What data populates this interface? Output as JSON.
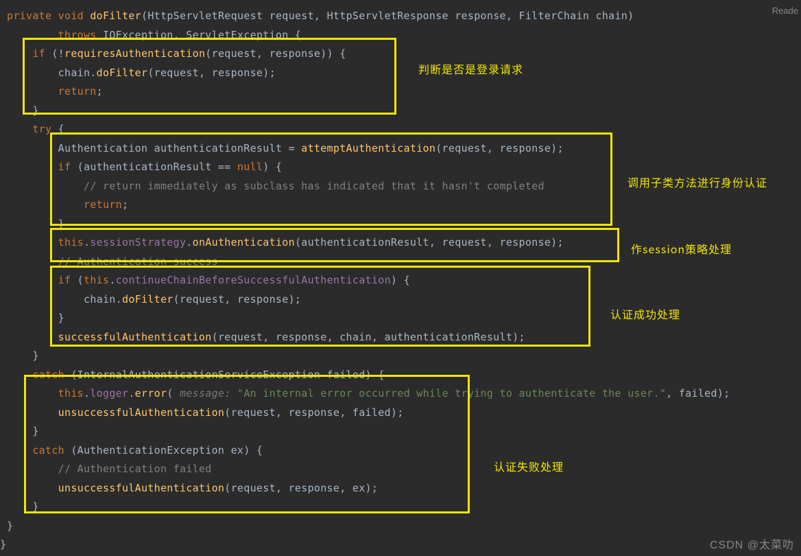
{
  "reader_label": "Reade",
  "watermark": "CSDN @太菜叻",
  "anno": {
    "check_login": "判断是否是登录请求",
    "call_subclass": "调用子类方法进行身份认证",
    "session_policy": "作session策略处理",
    "auth_ok": "认证成功处理",
    "auth_fail": "认证失败处理"
  },
  "code": {
    "lines": {
      "l1_private": "private",
      "l1_void": "void",
      "l1_doFilter": "doFilter",
      "l1_params": "(HttpServletRequest request, HttpServletResponse response, FilterChain chain)",
      "l2_throws": "throws",
      "l2_exceptions": " IOException, ServletException {",
      "l3_if": "if",
      "l3_cond_a": " (!",
      "l3_requiresAuthentication": "requiresAuthentication",
      "l3_cond_b": "(request, response)) {",
      "l4a": "chain.",
      "l4_doFilter": "doFilter",
      "l4b": "(request, response);",
      "l5_return": "return",
      "l5_semi": ";",
      "l6_close": "}",
      "l7_try": "try",
      "l7_open": " {",
      "l8_auth_a": "Authentication authenticationResult = ",
      "l8_attemptAuthentication": "attemptAuthentication",
      "l8_auth_b": "(request, response);",
      "l9_if": "if",
      "l9_cond_a": " (authenticationResult == ",
      "l9_null": "null",
      "l9_cond_b": ") {",
      "l10_cmt": "// return immediately as subclass has indicated that it hasn't completed",
      "l11_return": "return",
      "l11_semi": ";",
      "l12_close": "}",
      "l13_this": "this",
      "l13_dot1": ".",
      "l13_sessionStrategy": "sessionStrategy",
      "l13_dot2": ".",
      "l13_onAuthentication": "onAuthentication",
      "l13_args": "(authenticationResult, request, response);",
      "l14_cmt": "// Authentication success",
      "l15_if": "if",
      "l15_cond_a": " (",
      "l15_this": "this",
      "l15_dot": ".",
      "l15_continueChain": "continueChainBeforeSuccessfulAuthentication",
      "l15_cond_b": ") {",
      "l16a": "chain.",
      "l16_doFilter": "doFilter",
      "l16b": "(request, response);",
      "l17_close": "}",
      "l18_successfulAuth": "successfulAuthentication",
      "l18_args": "(request, response, chain, authenticationResult);",
      "l19_close": "}",
      "l20_catch": "catch",
      "l20_a": " (InternalAuthenticationServiceException failed) {",
      "l21_this": "this",
      "l21_dot": ".",
      "l21_logger": "logger",
      "l21_dot2": ".",
      "l21_error": "error",
      "l21_open": "(",
      "l21_hint": " message: ",
      "l21_str": "\"An internal error occurred while trying to authenticate the user.\"",
      "l21_end": ", failed);",
      "l22_unsuc": "unsuccessfulAuthentication",
      "l22_args": "(request, response, failed);",
      "l23_close": "}",
      "l24_catch": "catch",
      "l24_a": " (AuthenticationException ex) {",
      "l25_cmt": "// Authentication failed",
      "l26_unsuc": "unsuccessfulAuthentication",
      "l26_args": "(request, response, ex);",
      "l27_close": "}",
      "l28_close": "}",
      "l29_close": "}"
    }
  }
}
